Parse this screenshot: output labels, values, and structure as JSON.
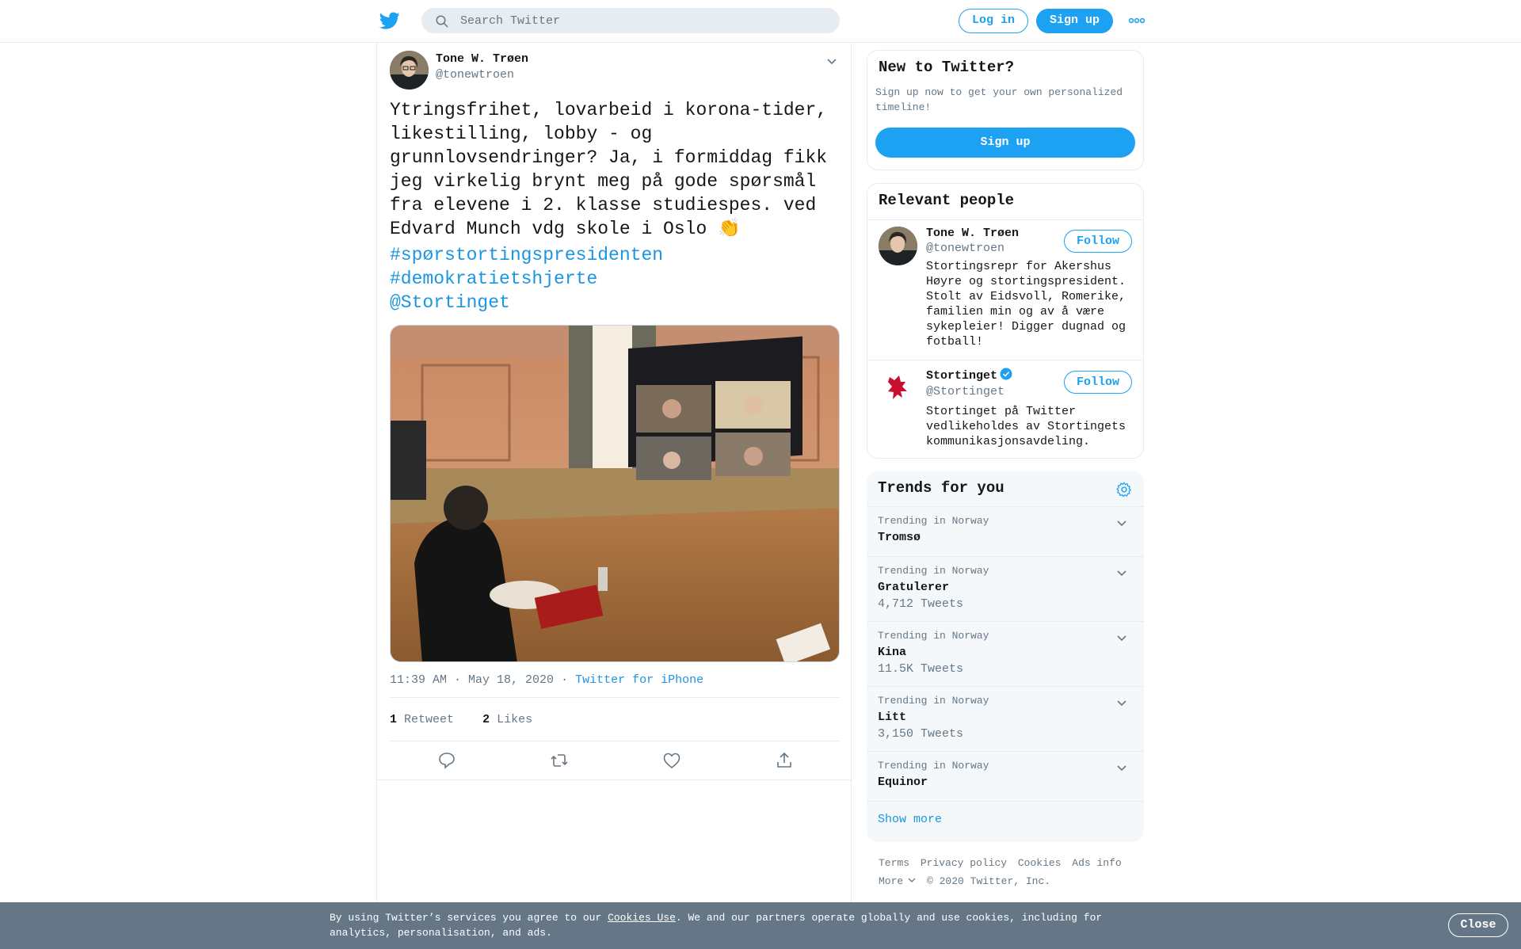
{
  "header": {
    "logo_icon": "twitter-bird-icon",
    "search_placeholder": "Search Twitter",
    "login_label": "Log in",
    "signup_label": "Sign up",
    "more_icon": "more-dots-icon"
  },
  "tweet": {
    "author_name": "Tone W. Trøen",
    "author_handle": "@tonewtroen",
    "text": "Ytringsfrihet, lovarbeid i korona-tider,\nlikestilling, lobby - og\ngrunnlovsendringer? Ja, i formiddag fikk\njeg virkelig brynt meg på gode spørsmål\nfra elevene i 2. klasse studiespes. ved\nEdvard Munch vdg skole i Oslo 👏",
    "hashtag1": "#spørstortingspresidenten",
    "hashtag2": "#demokratietshjerte",
    "mention": "@Stortinget",
    "timestamp": "11:39 AM · May 18, 2020",
    "separator": "·",
    "source": "Twitter for iPhone",
    "retweet_count": "1",
    "retweet_label": "Retweet",
    "like_count": "2",
    "like_label": "Likes",
    "actions": [
      "reply-icon",
      "retweet-icon",
      "like-icon",
      "share-icon"
    ]
  },
  "new_to_twitter": {
    "title": "New to Twitter?",
    "subtitle": "Sign up now to get your own personalized timeline!",
    "button": "Sign up"
  },
  "relevant_people": {
    "title": "Relevant people",
    "people": [
      {
        "name": "Tone W. Trøen",
        "handle": "@tonewtroen",
        "bio": "Stortingsrepr for Akershus Høyre og stortingspresident. Stolt av Eidsvoll, Romerike, familien min og av å være sykepleier! Digger dugnad og fotball!",
        "follow": "Follow"
      },
      {
        "name": "Stortinget",
        "handle": "@Stortinget",
        "bio": "Stortinget på Twitter vedlikeholdes av Stortingets kommunikasjonsavdeling.",
        "follow": "Follow",
        "verified": true
      }
    ]
  },
  "trends": {
    "title": "Trends for you",
    "items": [
      {
        "context": "Trending in Norway",
        "name": "Tromsø",
        "count": ""
      },
      {
        "context": "Trending in Norway",
        "name": "Gratulerer",
        "count": "4,712 Tweets"
      },
      {
        "context": "Trending in Norway",
        "name": "Kina",
        "count": "11.5K Tweets"
      },
      {
        "context": "Trending in Norway",
        "name": "Litt",
        "count": "3,150 Tweets"
      },
      {
        "context": "Trending in Norway",
        "name": "Equinor",
        "count": ""
      }
    ],
    "show_more": "Show more"
  },
  "footer": {
    "links": [
      "Terms",
      "Privacy policy",
      "Cookies",
      "Ads info"
    ],
    "more": "More",
    "copyright": "© 2020 Twitter, Inc."
  },
  "cookie_bar": {
    "text_before": "By using Twitter’s services you agree to our ",
    "link": "Cookies Use",
    "text_after": ". We and our partners operate globally and use cookies, including for analytics, personalisation, and ads.",
    "close": "Close"
  },
  "colors": {
    "accent": "#1da1f2",
    "link": "#1b95e0",
    "muted": "#657786",
    "cookie_bar": "#657786"
  }
}
